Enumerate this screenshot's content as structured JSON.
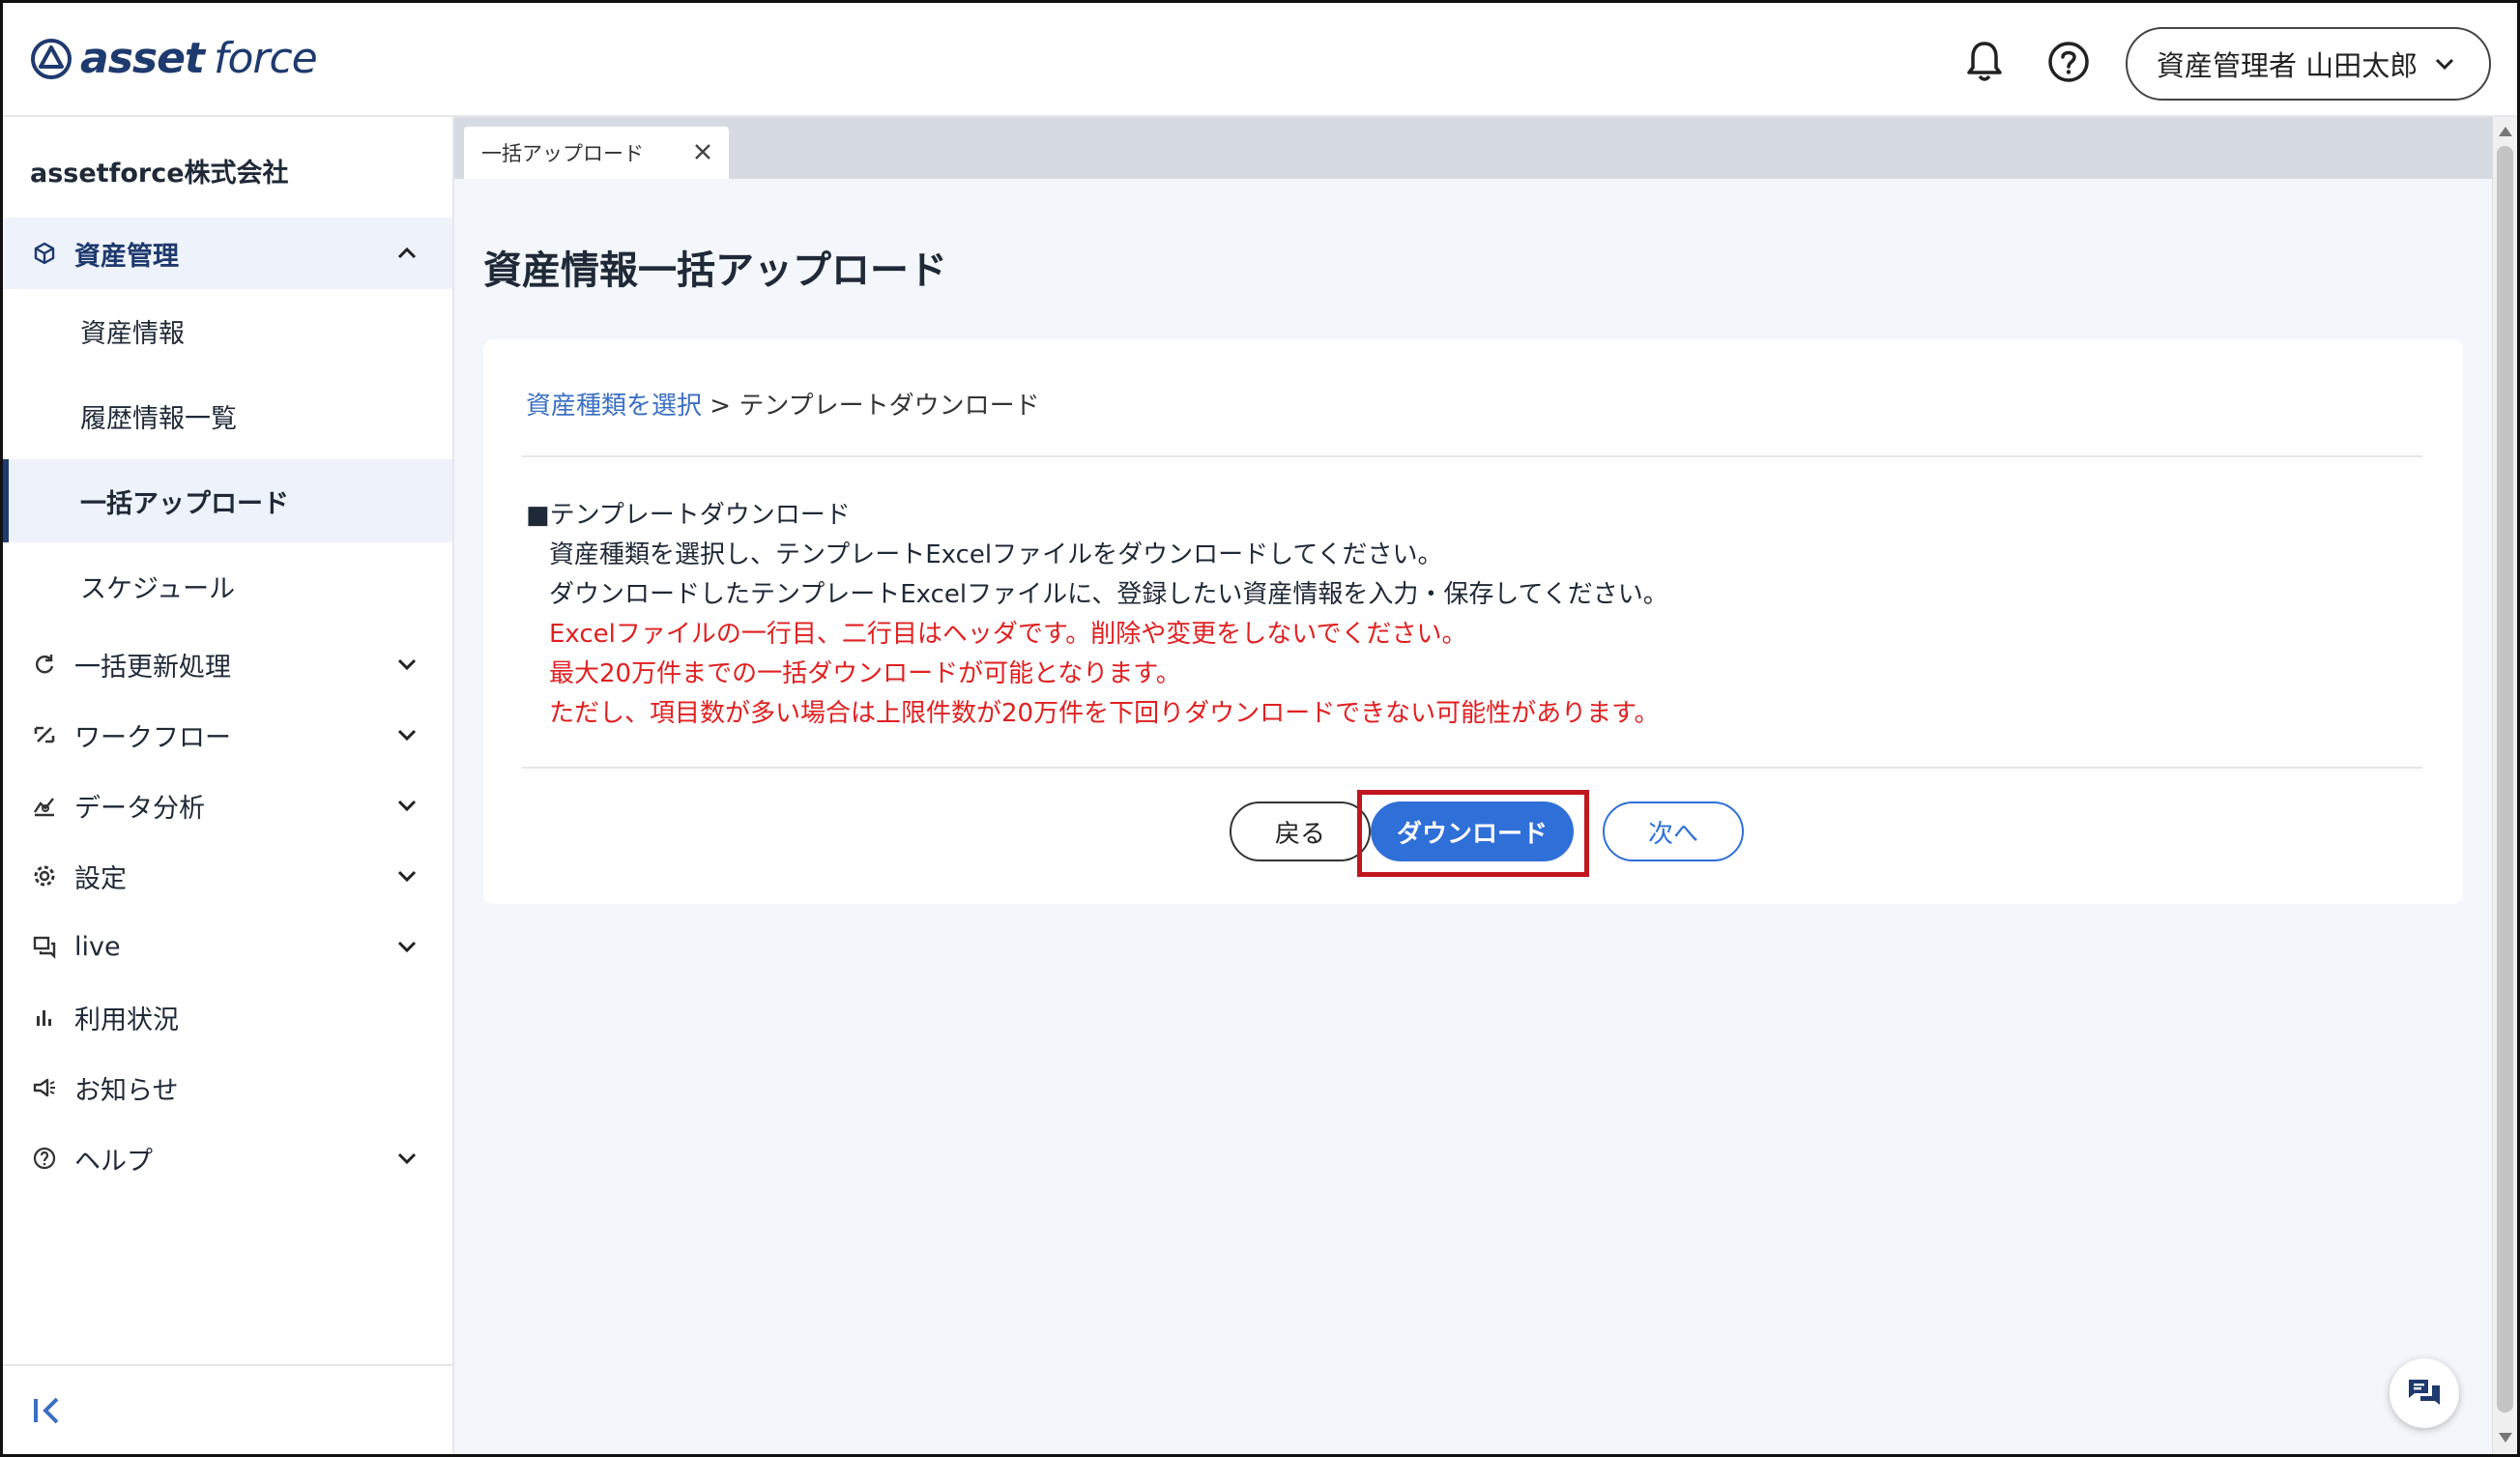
{
  "header": {
    "logo_text_1": "asset",
    "logo_text_2": "force",
    "user_menu_label": "資産管理者 山田太郎"
  },
  "sidebar": {
    "company_name": "assetforce株式会社",
    "asset_management_label": "資産管理",
    "sub_items": [
      "資産情報",
      "履歴情報一覧",
      "一括アップロード",
      "スケジュール"
    ],
    "items": [
      "一括更新処理",
      "ワークフロー",
      "データ分析",
      "設定",
      "live",
      "利用状況",
      "お知らせ",
      "ヘルプ"
    ]
  },
  "tabs": {
    "active_tab_label": "一括アップロード"
  },
  "main": {
    "page_title": "資産情報一括アップロード",
    "breadcrumb_link": "資産種類を選択",
    "breadcrumb_separator": " > ",
    "breadcrumb_current": "テンプレートダウンロード",
    "section_heading": "■テンプレートダウンロード",
    "instructions": [
      "資産種類を選択し、テンプレートExcelファイルをダウンロードしてください。",
      "ダウンロードしたテンプレートExcelファイルに、登録したい資産情報を入力・保存してください。"
    ],
    "warnings": [
      "Excelファイルの一行目、二行目はヘッダです。削除や変更をしないでください。",
      "最大20万件までの一括ダウンロードが可能となります。",
      "ただし、項目数が多い場合は上限件数が20万件を下回りダウンロードできない可能性があります。"
    ],
    "buttons": {
      "back": "戻る",
      "download": "ダウンロード",
      "next": "次へ"
    }
  },
  "colors": {
    "brand": "#1e3a6e",
    "primary_button": "#2f6fd8",
    "link": "#3a6fc4",
    "warning_text": "#e02020",
    "highlight_box": "#c0161f"
  },
  "icons": {
    "logo": "assetforce-logo-icon",
    "notification": "bell-icon",
    "help": "question-circle-icon",
    "chat": "chat-icon"
  }
}
